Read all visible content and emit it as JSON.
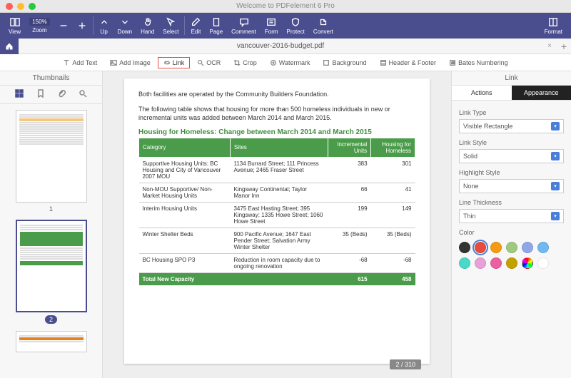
{
  "window": {
    "title": "Welcome to PDFelement 6 Pro"
  },
  "toolbar": {
    "view": "View",
    "zoom": "Zoom",
    "zoom_val": "150%",
    "up": "Up",
    "down": "Down",
    "hand": "Hand",
    "select": "Select",
    "edit": "Edit",
    "page": "Page",
    "comment": "Comment",
    "form": "Form",
    "protect": "Protect",
    "convert": "Convert",
    "format": "Format"
  },
  "tabs": {
    "file": "vancouver-2016-budget.pdf"
  },
  "subtoolbar": {
    "add_text": "Add Text",
    "add_image": "Add Image",
    "link": "Link",
    "ocr": "OCR",
    "crop": "Crop",
    "watermark": "Watermark",
    "background": "Background",
    "header_footer": "Header & Footer",
    "bates": "Bates Numbering"
  },
  "thumbnails": {
    "title": "Thumbnails",
    "page1": "1",
    "page2": "2"
  },
  "document": {
    "para1": "Both facilities are operated by the Community Builders Foundation.",
    "para2": "The following table shows that housing for more than 500 homeless individuals in new or incremental units was added between March 2014 and March 2015.",
    "table_title": "Housing for Homeless: Change between March 2014 and March 2015",
    "headers": {
      "c1": "Category",
      "c2": "Sites",
      "c3": "Incremental Units",
      "c4": "Housing for Homeless"
    },
    "rows": [
      {
        "c1": "Supportive Housing Units: BC Housing and City of Vancouver 2007 MOU",
        "c2": "1134 Burrard Street; 111 Princess Avenue; 2465 Fraser Street",
        "c3": "383",
        "c4": "301"
      },
      {
        "c1": "Non-MOU Supportive/ Non-Market Housing Units",
        "c2": "Kingsway Continental; Taylor Manor Inn",
        "c3": "66",
        "c4": "41"
      },
      {
        "c1": "Interim Housing Units",
        "c2": "3475 East Hasting Street; 395 Kingsway; 1335 Howe Street; 1060 Howe Street",
        "c3": "199",
        "c4": "149"
      },
      {
        "c1": "Winter Shelter Beds",
        "c2": "900 Pacific Avenue; 1647 East Pender Street; Salvation Army Winter Shelter",
        "c3": "35 (Beds)",
        "c4": "35 (Beds)"
      },
      {
        "c1": "BC Housing SPO P3",
        "c2": "Reduction in room capacity due to ongoing renovation",
        "c3": "-68",
        "c4": "-68"
      }
    ],
    "total": {
      "c1": "Total New Capacity",
      "c3": "615",
      "c4": "458"
    },
    "page_indicator": "2 / 310"
  },
  "rpanel": {
    "title": "Link",
    "tab_actions": "Actions",
    "tab_appearance": "Appearance",
    "link_type_lbl": "Link Type",
    "link_type_val": "Visible Rectangle",
    "link_style_lbl": "Link Style",
    "link_style_val": "Solid",
    "highlight_lbl": "Highlight Style",
    "highlight_val": "None",
    "thickness_lbl": "Line Thickness",
    "thickness_val": "Thin",
    "color_lbl": "Color",
    "colors": [
      "#333333",
      "#e74c3c",
      "#f39c12",
      "#9fc97f",
      "#8fa7e8",
      "#6fb8f0",
      "#4ad8c8",
      "#e8a1d8",
      "#ec5fa0",
      "#c4a100",
      "#dddddd",
      "#ffffff"
    ]
  }
}
